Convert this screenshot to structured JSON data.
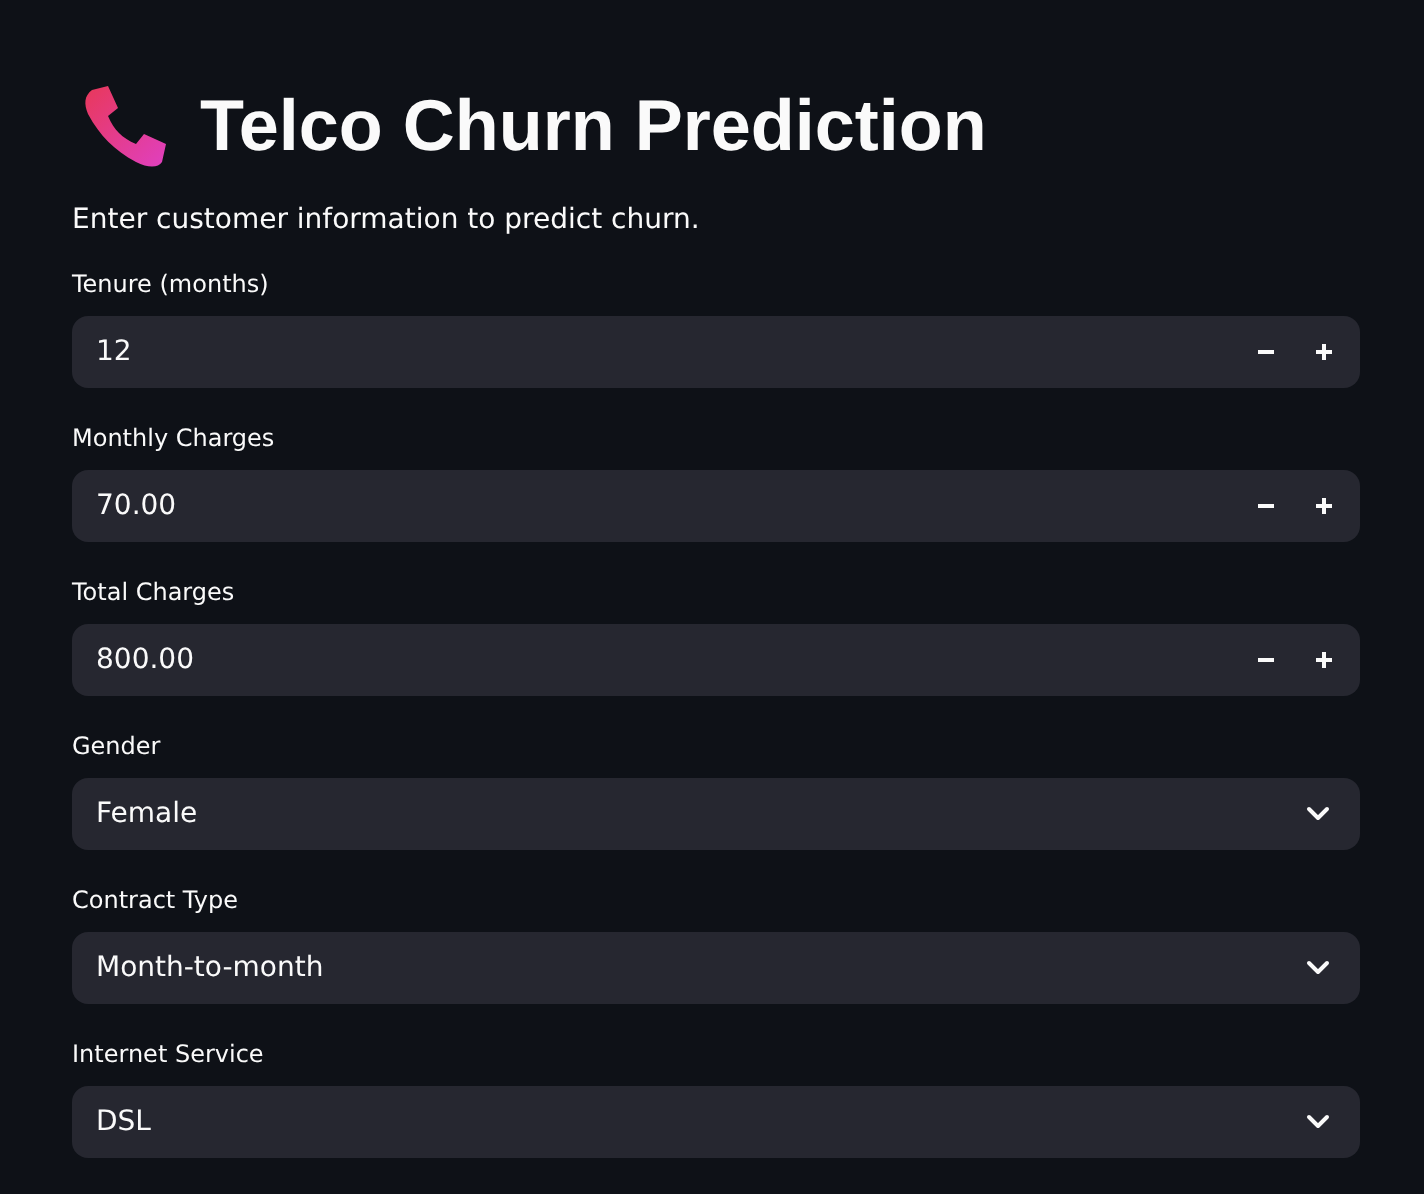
{
  "title": "Telco Churn Prediction",
  "subtitle": "Enter customer information to predict churn.",
  "fields": [
    {
      "kind": "number",
      "label": "Tenure (months)",
      "value": "12"
    },
    {
      "kind": "number",
      "label": "Monthly Charges",
      "value": "70.00"
    },
    {
      "kind": "number",
      "label": "Total Charges",
      "value": "800.00"
    },
    {
      "kind": "select",
      "label": "Gender",
      "value": "Female"
    },
    {
      "kind": "select",
      "label": "Contract Type",
      "value": "Month-to-month"
    },
    {
      "kind": "select",
      "label": "Internet Service",
      "value": "DSL"
    }
  ]
}
